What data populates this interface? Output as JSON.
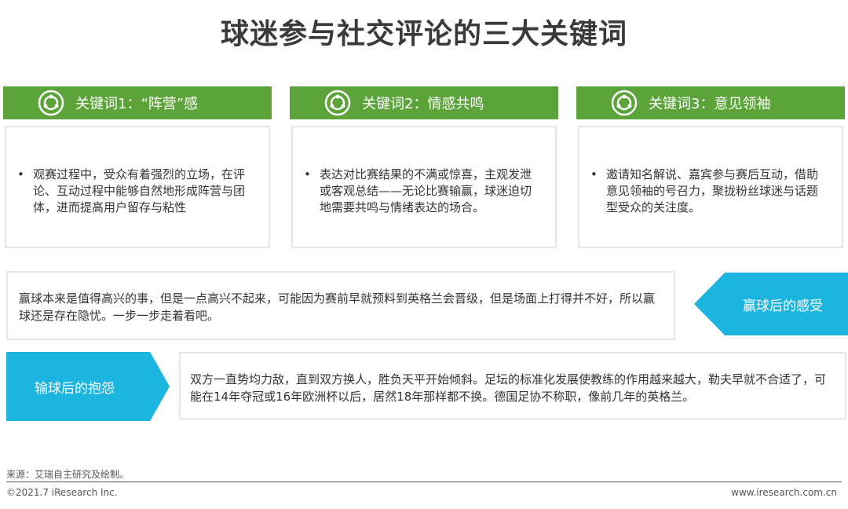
{
  "title": "球迷参与社交评论的三大关键词",
  "keywords": [
    {
      "header": "关键词1：“阵营”感",
      "icon": "target-circle-icon",
      "text": "观赛过程中，受众有着强烈的立场，在评论、互动过程中能够自然地形成阵营与团体，进而提高用户留存与粘性"
    },
    {
      "header": "关键词2：情感共鸣",
      "icon": "target-circle-icon",
      "text": "表达对比赛结果的不满或惊喜，主观发泄或客观总结——无论比赛输赢，球迷迫切地需要共鸣与情绪表达的场合。"
    },
    {
      "header": "关键词3：意见领袖",
      "icon": "target-circle-icon",
      "text": "邀请知名解说、嘉宾参与赛后互动，借助意见领袖的号召力，聚拢粉丝球迷与话题型受众的关注度。"
    }
  ],
  "win": {
    "label": "赢球后的感受",
    "text": "赢球本来是值得高兴的事，但是一点高兴不起来，可能因为赛前早就预料到英格兰会晋级，但是场面上打得并不好，所以赢球还是存在隐忧。一步一步走着看吧。"
  },
  "lose": {
    "label": "输球后的抱怨",
    "text": "双方一直势均力敌，直到双方换人，胜负天平开始倾斜。足坛的标准化发展使教练的作用越来越大，勒夫早就不合适了，可能在14年夺冠或16年欧洲杯以后，居然18年那样都不换。德国足协不称职，像前几年的英格兰。"
  },
  "footer": {
    "source": "来源：艾瑞自主研究及绘制。",
    "copyright": "©2021.7 iResearch Inc.",
    "website": "www.iresearch.com.cn"
  },
  "colors": {
    "green": "#5ca33a",
    "blue": "#1cb5e0",
    "border": "#e6e6e6"
  }
}
